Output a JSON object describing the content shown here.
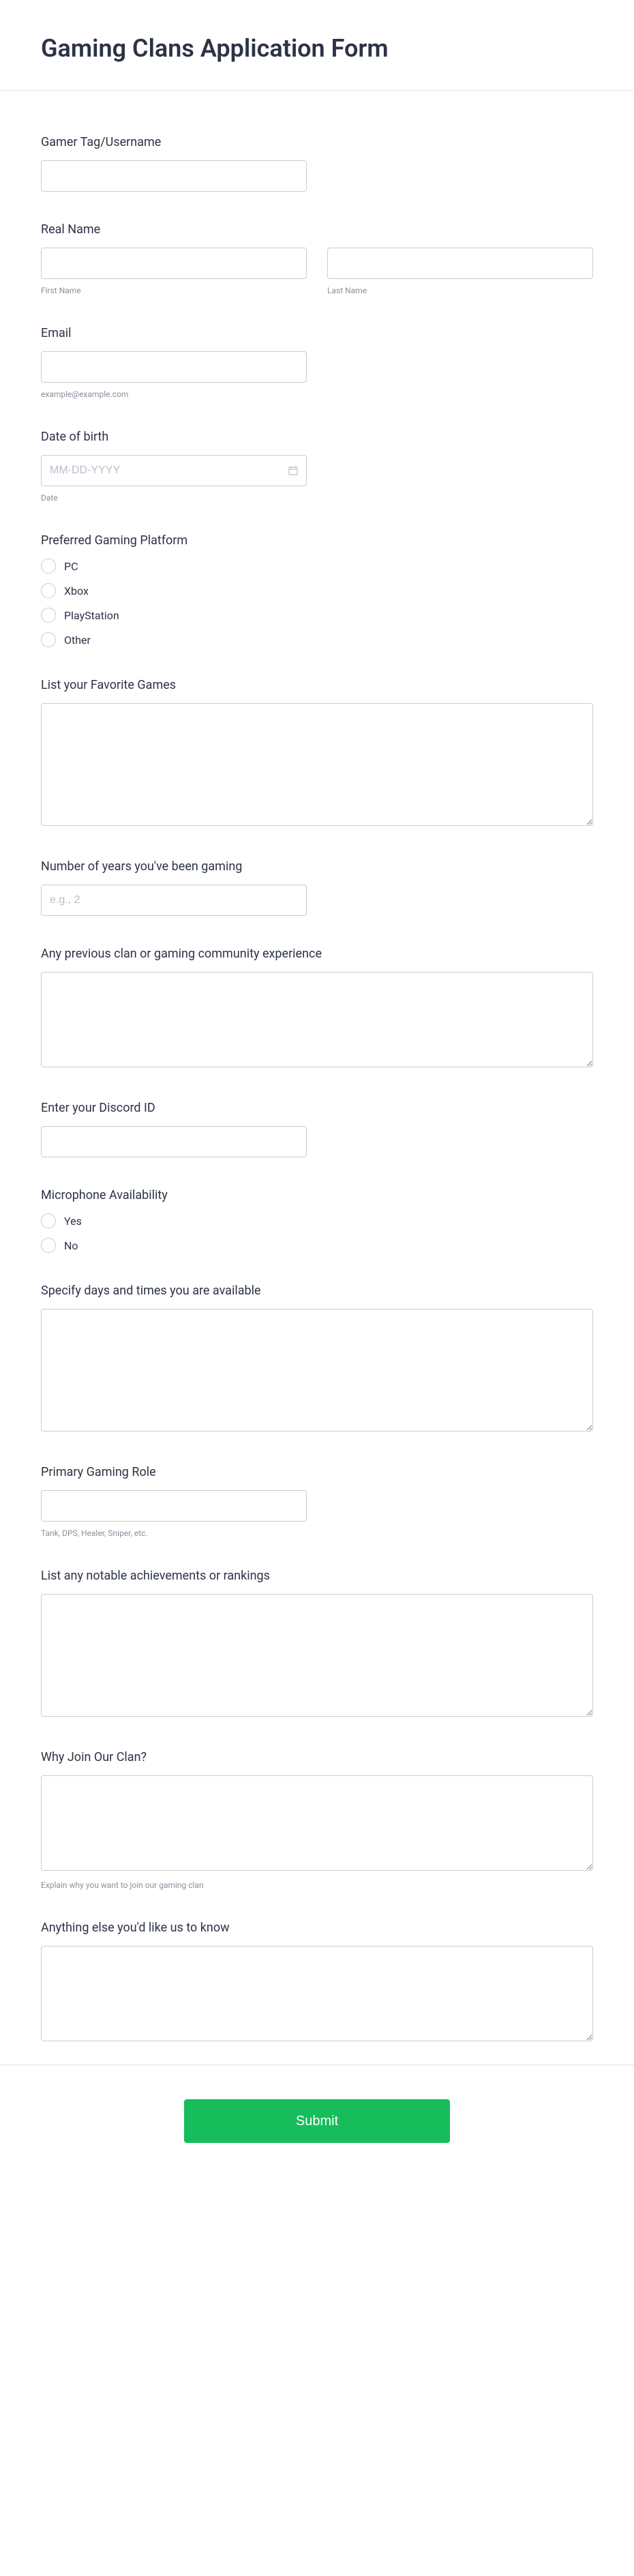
{
  "header": {
    "title": "Gaming Clans Application Form"
  },
  "fields": {
    "gamerTag": {
      "label": "Gamer Tag/Username"
    },
    "realName": {
      "label": "Real Name",
      "firstSub": "First Name",
      "lastSub": "Last Name"
    },
    "email": {
      "label": "Email",
      "sublabel": "example@example.com"
    },
    "dob": {
      "label": "Date of birth",
      "placeholder": "MM-DD-YYYY",
      "sublabel": "Date"
    },
    "platform": {
      "label": "Preferred Gaming Platform",
      "options": [
        "PC",
        "Xbox",
        "PlayStation",
        "Other"
      ]
    },
    "favoriteGames": {
      "label": "List your Favorite Games"
    },
    "yearsGaming": {
      "label": "Number of years you've been gaming",
      "placeholder": "e.g., 2"
    },
    "prevExperience": {
      "label": "Any previous clan or gaming community experience"
    },
    "discord": {
      "label": "Enter your Discord ID"
    },
    "micAvail": {
      "label": "Microphone Availability",
      "options": [
        "Yes",
        "No"
      ]
    },
    "availability": {
      "label": "Specify days and times you are available"
    },
    "role": {
      "label": "Primary Gaming Role",
      "sublabel": "Tank, DPS, Healer, Sniper, etc."
    },
    "achievements": {
      "label": "List any notable achievements or rankings"
    },
    "whyJoin": {
      "label": "Why Join Our Clan?",
      "sublabel": "Explain why you want to join our gaming clan"
    },
    "anythingElse": {
      "label": "Anything else you'd like us to know"
    }
  },
  "footer": {
    "submit": "Submit"
  }
}
